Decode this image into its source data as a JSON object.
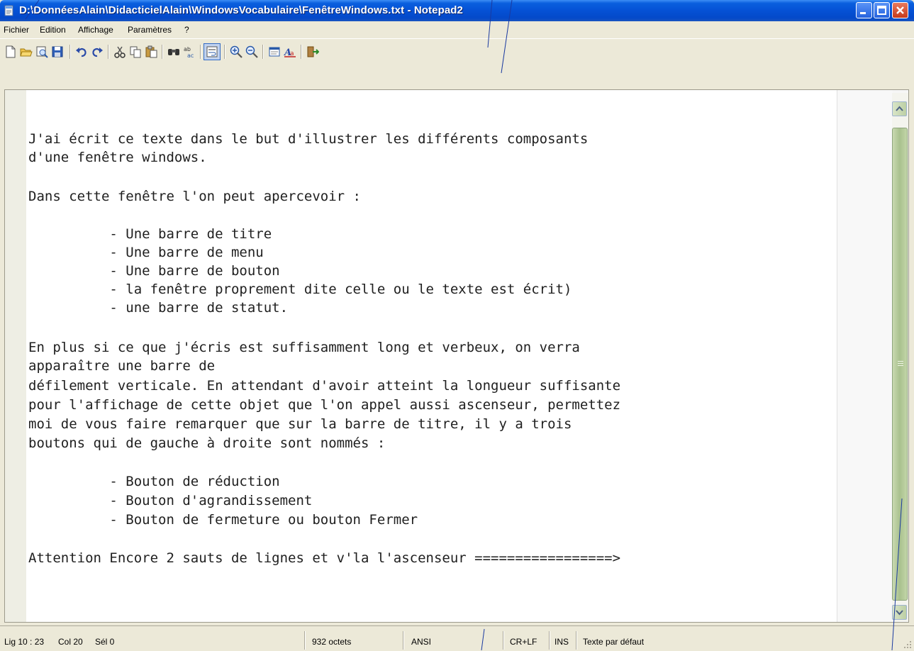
{
  "window": {
    "title": "D:\\DonnéesAlain\\DidacticielAlain\\WindowsVocabulaire\\FenêtreWindows.txt - Notepad2",
    "app_icon": "notepad-icon",
    "buttons": {
      "minimize": "minimize-icon",
      "maximize": "maximize-icon",
      "close": "close-icon"
    }
  },
  "menu": {
    "items": [
      "Fichier",
      "Edition",
      "Affichage",
      "Paramètres",
      "?"
    ]
  },
  "toolbar": {
    "buttons": [
      "new-file-icon",
      "open-folder-icon",
      "browse-icon",
      "save-icon",
      "undo-icon",
      "redo-icon",
      "cut-icon",
      "copy-icon",
      "paste-icon",
      "find-icon",
      "replace-icon",
      "word-wrap-icon",
      "zoom-in-icon",
      "zoom-out-icon",
      "scheme-icon",
      "font-icon",
      "exit-icon"
    ]
  },
  "editor": {
    "lines": [
      "",
      "J'ai écrit ce texte dans le but d'illustrer les différents composants",
      "d'une fenêtre windows.",
      "",
      "Dans cette fenêtre l'on peut apercevoir :",
      "",
      "          - Une barre de titre",
      "          - Une barre de menu",
      "          - Une barre de bouton",
      "          - la fenêtre proprement dite celle ou le texte est écrit)",
      "          - une barre de statut.",
      "",
      "En plus si ce que j'écris est suffisamment long et verbeux, on verra",
      "apparaître une barre de",
      "défilement verticale. En attendant d'avoir atteint la longueur suffisante",
      "pour l'affichage de cette objet que l'on appel aussi ascenseur, permettez",
      "moi de vous faire remarquer que sur la barre de titre, il y a trois",
      "boutons qui de gauche à droite sont nommés :",
      "",
      "          - Bouton de réduction",
      "          - Bouton d'agrandissement",
      "          - Bouton de fermeture ou bouton Fermer",
      "",
      "Attention Encore 2 sauts de lignes et v'la l'ascenseur =================>"
    ]
  },
  "statusbar": {
    "position": "Lig 10 : 23",
    "column": "Col 20",
    "selection": "Sél 0",
    "size": "932 octets",
    "encoding": "ANSI",
    "line_endings": "CR+LF",
    "mode": "INS",
    "scheme": "Texte par défaut"
  }
}
